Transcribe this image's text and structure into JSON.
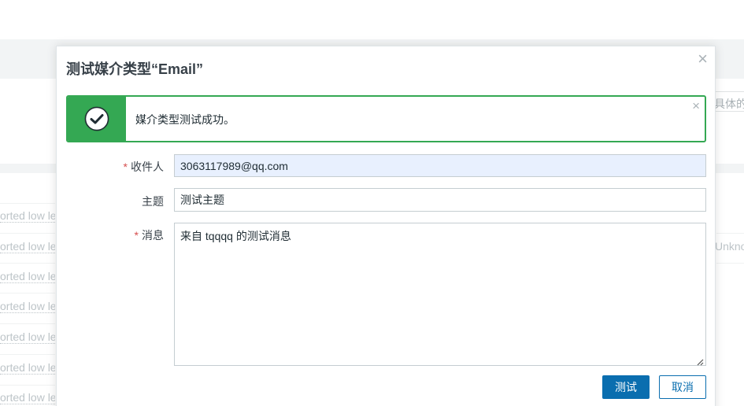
{
  "background": {
    "row_text": "orted low le",
    "right_filter_text": "具体的",
    "right_row_text": "Unknow"
  },
  "dialog": {
    "title": "测试媒介类型“Email”",
    "close_symbol": "×",
    "message": {
      "text": "媒介类型测试成功。",
      "status_color": "#34a853",
      "close_symbol": "×"
    },
    "fields": {
      "recipient": {
        "label": "收件人",
        "required": true,
        "value": "3063117989@qq.com"
      },
      "subject": {
        "label": "主题",
        "required": false,
        "value": "测试主题"
      },
      "message": {
        "label": "消息",
        "required": true,
        "value": "来自 tqqqq 的测试消息"
      }
    },
    "buttons": {
      "test": "测试",
      "cancel": "取消"
    },
    "accent_color": "#0a6eaf"
  }
}
